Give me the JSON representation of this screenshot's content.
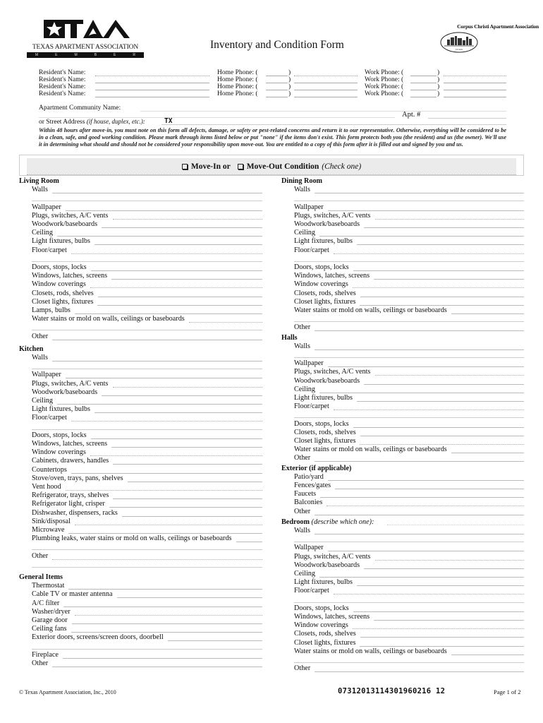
{
  "header": {
    "taa_tagline": "TEXAS APARTMENT ASSOCIATION",
    "taa_member_letters": [
      "M",
      "E",
      "M",
      "B",
      "E",
      "R"
    ],
    "title": "Inventory and Condition Form",
    "cca_name": "Corpus Christi Apartment Association",
    "cca_seal_text": "CCAA"
  },
  "residents": {
    "rows": [
      {
        "name_label": "Resident's Name:",
        "name_value": "",
        "home_label": "Home Phone: (",
        "home_close": ")",
        "home_area": "",
        "home_value": "",
        "work_label": "Work Phone: (",
        "work_close": ")",
        "work_area": "",
        "work_value": ""
      },
      {
        "name_label": "Resident's Name:",
        "name_value": "",
        "home_label": "Home Phone: (",
        "home_close": ")",
        "home_area": "",
        "home_value": "",
        "work_label": "Work Phone: (",
        "work_close": ")",
        "work_area": "",
        "work_value": ""
      },
      {
        "name_label": "Resident's Name:",
        "name_value": "",
        "home_label": "Home Phone: (",
        "home_close": ")",
        "home_area": "",
        "home_value": "",
        "work_label": "Work Phone: (",
        "work_close": ")",
        "work_area": "",
        "work_value": ""
      },
      {
        "name_label": "Resident's Name:",
        "name_value": "",
        "home_label": "Home Phone: (",
        "home_close": ")",
        "home_area": "",
        "home_value": "",
        "work_label": "Work Phone: (",
        "work_close": ")",
        "work_area": "",
        "work_value": ""
      }
    ],
    "community_label": "Apartment Community Name:",
    "community_value": "",
    "apt_label": "Apt. #",
    "apt_value": "",
    "address_label": "or Street Address",
    "address_hint": "(if house, duplex, etc.):",
    "address_value": "TX"
  },
  "notice": "Within 48 hours after move-in, you must note on this form all defects, damage, or safety or pest-related concerns and return it to our representative. Otherwise, everything will be considered to be in a clean, safe, and good working condition. Please mark through items listed below or put \"none\" if the items don't exist. This form protects both you (the resident) and us (the owner). We'll use it in determining what should and should not be considered your responsibility upon move-out. You are entitled to a copy of this form after it is filled out and signed by you and us.",
  "condition": {
    "move_in_label": "Move-In or",
    "move_out_label": "Move-Out Condition",
    "hint": "(Check one)",
    "move_in_checked": false,
    "move_out_checked": false
  },
  "sections": {
    "living_room": {
      "title": "Living Room",
      "items": [
        "Walls",
        "",
        "Wallpaper",
        "Plugs, switches, A/C vents",
        "Woodwork/baseboards",
        "Ceiling",
        "Light fixtures, bulbs",
        "Floor/carpet",
        "",
        "Doors, stops, locks",
        "Windows, latches, screens",
        "Window coverings",
        "Closets, rods, shelves",
        "Closet lights, fixtures",
        "Lamps, bulbs",
        "Water stains or mold on walls, ceilings or baseboards",
        "",
        "Other"
      ]
    },
    "kitchen": {
      "title": "Kitchen",
      "items": [
        "Walls",
        "",
        "Wallpaper",
        "Plugs, switches, A/C vents",
        "Woodwork/baseboards",
        "Ceiling",
        "Light fixtures, bulbs",
        "Floor/carpet",
        "",
        "Doors, stops, locks",
        "Windows, latches, screens",
        "Window coverings",
        "Cabinets, drawers, handles",
        "Countertops",
        "Stove/oven, trays, pans, shelves",
        "Vent hood",
        "Refrigerator, trays, shelves",
        "Refrigerator light, crisper",
        "Dishwasher, dispensers, racks",
        "Sink/disposal",
        "Microwave",
        "Plumbing leaks, water stains or mold on walls, ceilings or baseboards",
        "",
        "Other",
        ""
      ]
    },
    "general": {
      "title": "General Items",
      "items": [
        "Thermostat",
        "Cable TV or master antenna",
        "A/C filter",
        "Washer/dryer",
        "Garage door",
        "Ceiling fans",
        "Exterior doors, screens/screen doors, doorbell",
        "",
        "Fireplace",
        "Other"
      ]
    },
    "dining_room": {
      "title": "Dining Room",
      "items": [
        "Walls",
        "",
        "Wallpaper",
        "Plugs, switches, A/C vents",
        "Woodwork/baseboards",
        "Ceiling",
        "Light fixtures, bulbs",
        "Floor/carpet",
        "",
        "Doors, stops, locks",
        "Windows, latches, screens",
        "Window coverings",
        "Closets, rods, shelves",
        "Closet lights, fixtures",
        "Water stains or mold on walls, ceilings or baseboards",
        "",
        "Other"
      ]
    },
    "halls": {
      "title": "Halls",
      "items": [
        "Walls",
        "",
        "Wallpaper",
        "Plugs, switches, A/C vents",
        "Woodwork/baseboards",
        "Ceiling",
        "Light fixtures, bulbs",
        "Floor/carpet",
        "",
        "Doors, stops, locks",
        "Closets, rods, shelves",
        "Closet lights, fixtures",
        "Water stains or mold on walls, ceilings or baseboards",
        "Other"
      ]
    },
    "exterior": {
      "title": "Exterior (if applicable)",
      "items": [
        "Patio/yard",
        "Fences/gates",
        "Faucets",
        "Balconies",
        "Other"
      ]
    },
    "bedroom": {
      "title": "Bedroom",
      "title_hint": "(describe which one):",
      "items": [
        "Walls",
        "",
        "Wallpaper",
        "Plugs, switches, A/C vents",
        "Woodwork/baseboards",
        "Ceiling",
        "Light fixtures, bulbs",
        "Floor/carpet",
        "",
        "Doors, stops, locks",
        "Windows, latches, screens",
        "Window coverings",
        "Closets, rods, shelves",
        "Closet lights, fixtures",
        "Water stains or mold on walls, ceilings or baseboards",
        "",
        "Other"
      ]
    }
  },
  "footer": {
    "copyright": "© Texas Apartment Association, Inc., 2010",
    "code": "07312013114301960216 12",
    "page": "Page 1 of 2"
  }
}
